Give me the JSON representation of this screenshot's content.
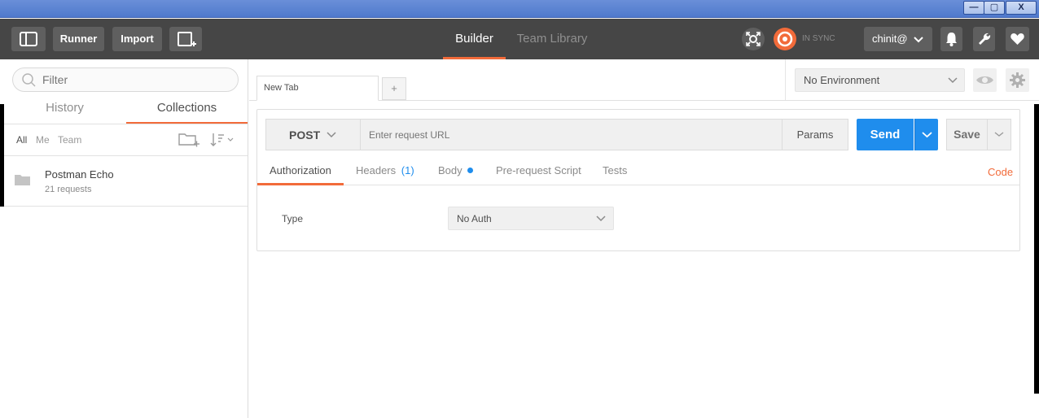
{
  "window": {
    "minimize_glyph": "—",
    "maximize_glyph": "▢",
    "close_glyph": "X"
  },
  "header": {
    "runner_label": "Runner",
    "import_label": "Import",
    "tabs": [
      {
        "label": "Builder",
        "active": true
      },
      {
        "label": "Team Library",
        "active": false
      }
    ],
    "sync_status": "IN SYNC",
    "user_label": "chinit@",
    "accent_color": "#f26b3a"
  },
  "sidebar": {
    "filter_placeholder": "Filter",
    "tabs": [
      {
        "label": "History",
        "active": false
      },
      {
        "label": "Collections",
        "active": true
      }
    ],
    "filters": [
      "All",
      "Me",
      "Team"
    ],
    "collections": [
      {
        "name": "Postman Echo",
        "meta": "21 requests"
      }
    ]
  },
  "main": {
    "tab_label": "New Tab",
    "add_tab_label": "+",
    "environment": "No Environment",
    "method": "POST",
    "url_placeholder": "Enter request URL",
    "params_label": "Params",
    "send_label": "Send",
    "send_color": "#1f8ded",
    "save_label": "Save",
    "subtabs": {
      "authorization": "Authorization",
      "headers": "Headers",
      "headers_count": "(1)",
      "body": "Body",
      "prerequest": "Pre-request Script",
      "tests": "Tests",
      "code": "Code"
    },
    "auth_type_label": "Type",
    "auth_type_value": "No Auth"
  }
}
